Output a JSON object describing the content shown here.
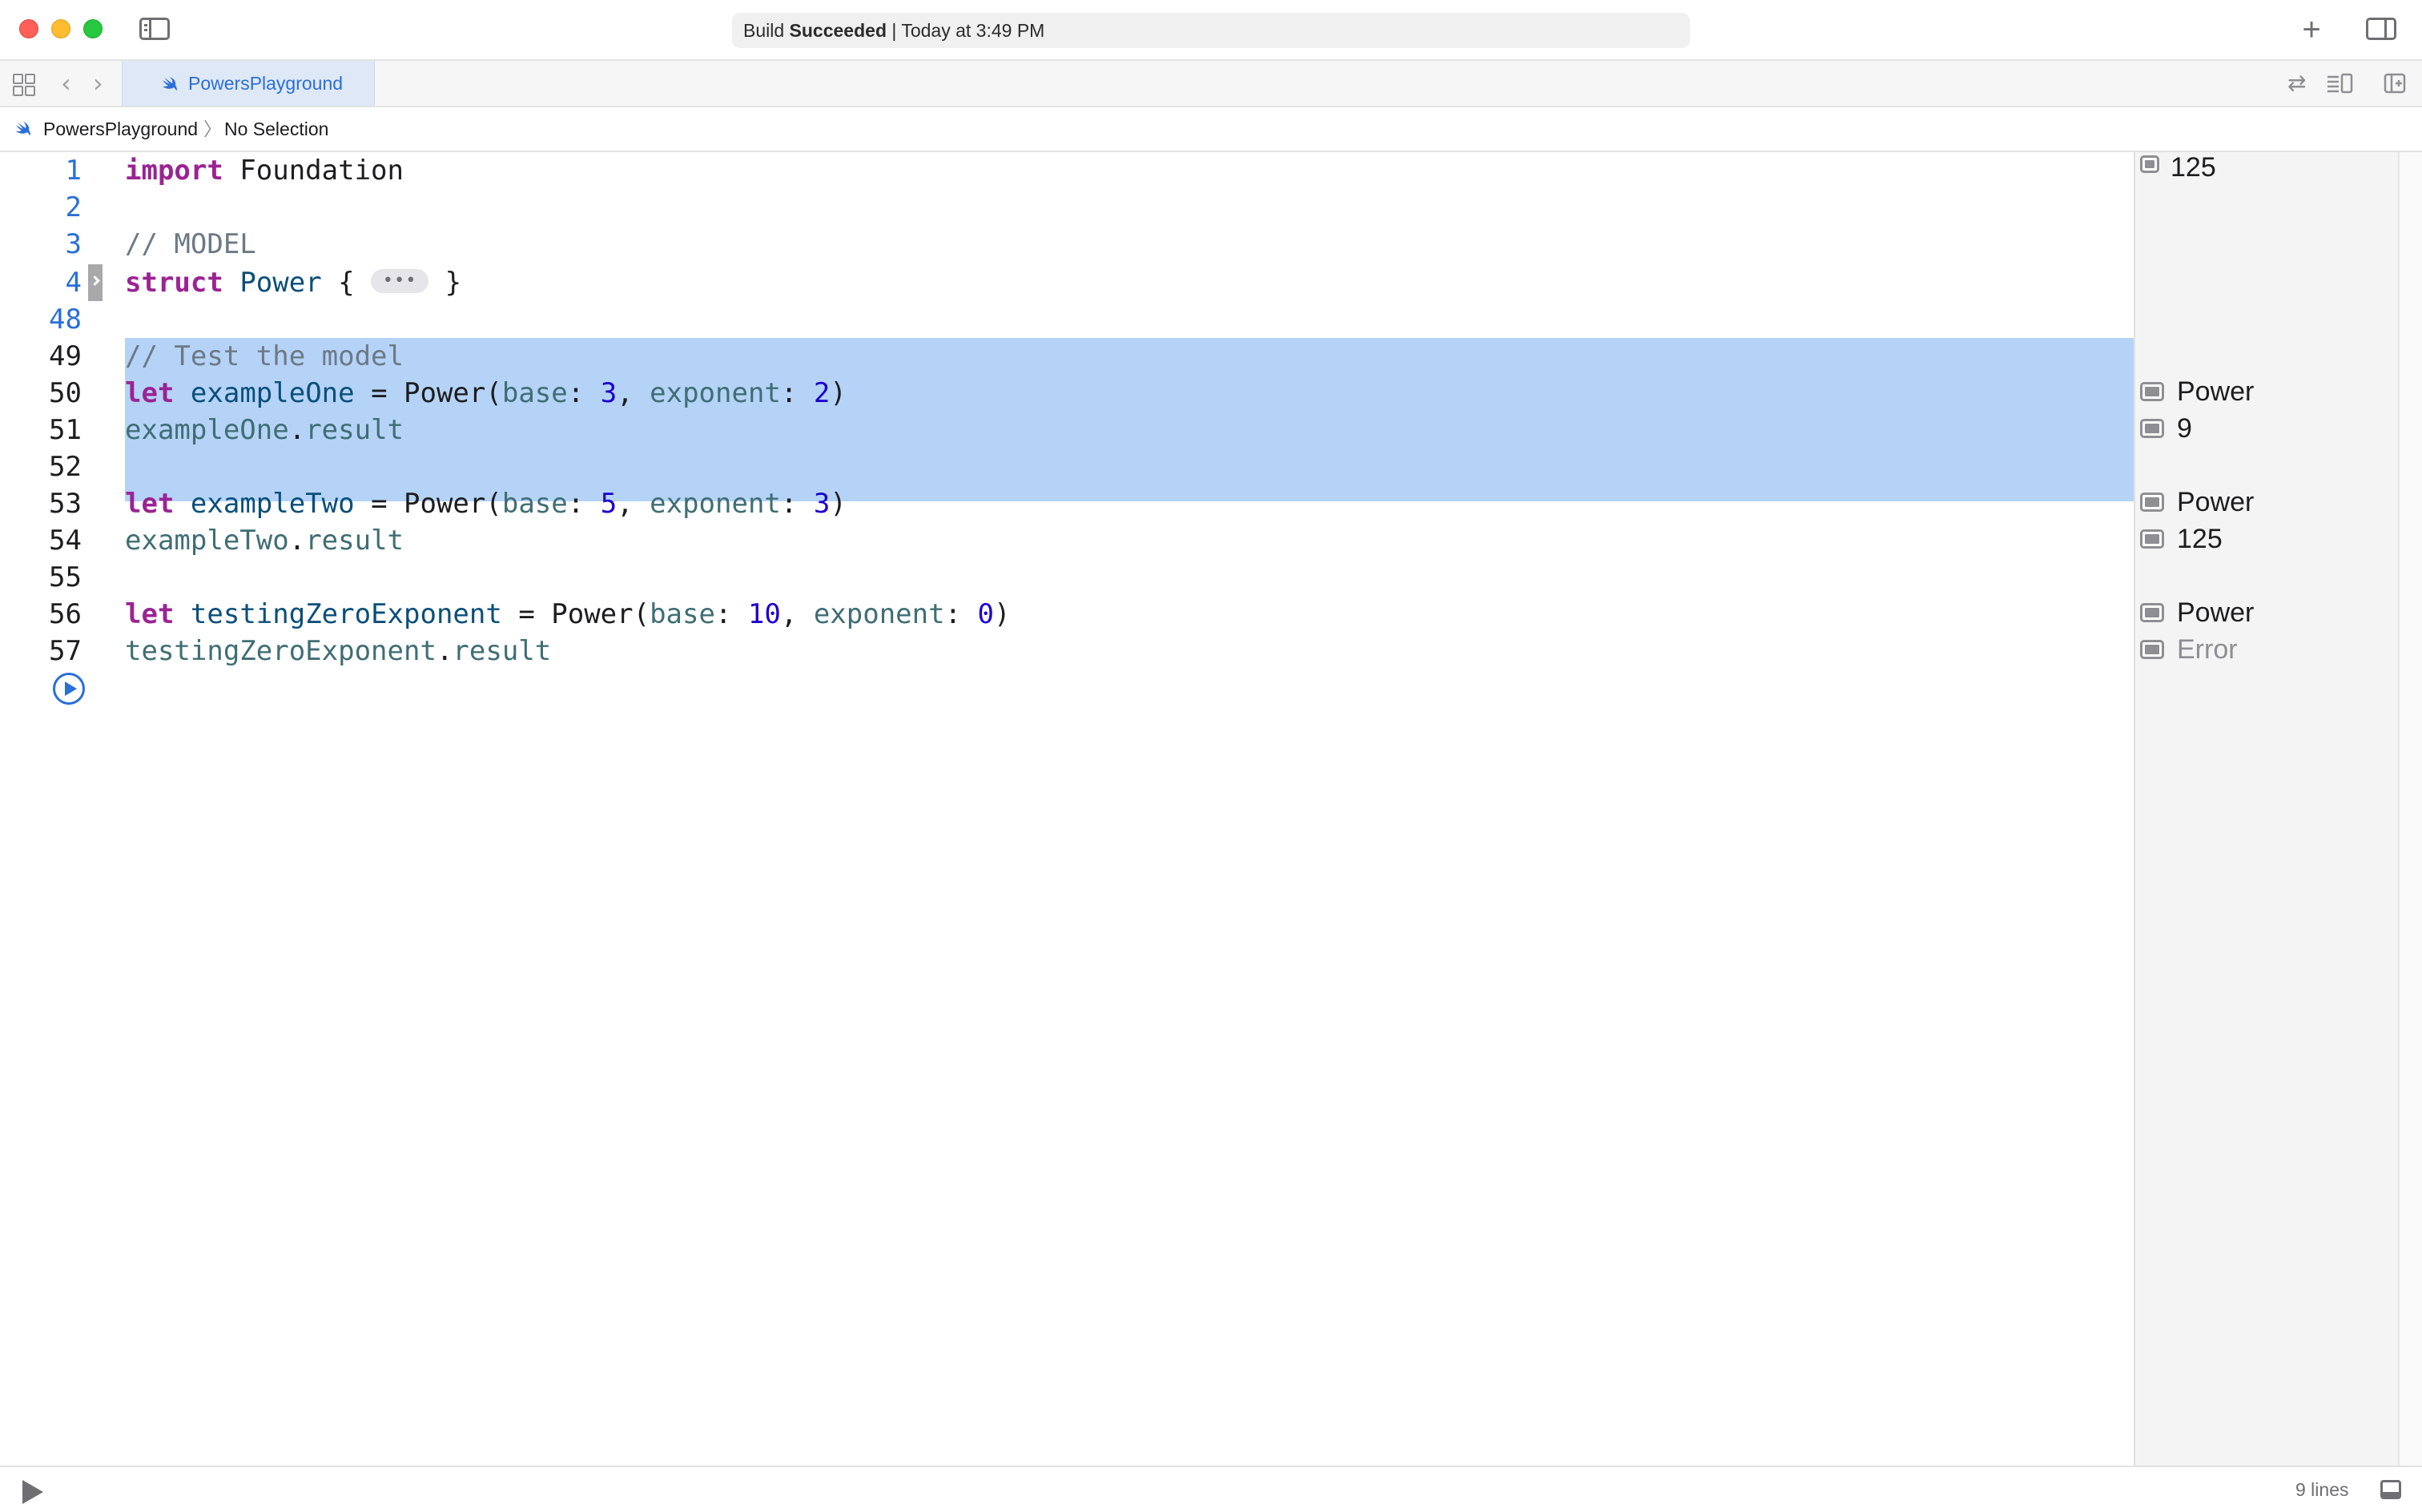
{
  "titlebar": {
    "activity_prefix": "Build ",
    "activity_status": "Succeeded",
    "activity_suffix": " | Today at 3:49 PM"
  },
  "tabbar": {
    "tab_label": "PowersPlayground"
  },
  "jumpbar": {
    "project": "PowersPlayground",
    "separator": "〉",
    "selection": "No Selection"
  },
  "editor": {
    "line_numbers": [
      "1",
      "2",
      "3",
      "4",
      "48",
      "49",
      "50",
      "51",
      "52",
      "53",
      "54",
      "55",
      "56",
      "57"
    ],
    "lines": {
      "l1": {
        "kw": "import",
        "rest": " Foundation"
      },
      "l3": {
        "comment": "// MODEL"
      },
      "l4": {
        "kw": "struct",
        "type": "Power",
        "open": " { ",
        "close": " }",
        "fold": "•••"
      },
      "l49": {
        "comment": "// Test the model"
      },
      "l50": {
        "kw": "let",
        "var": "exampleOne",
        "eq": " = Power(",
        "p1": "base",
        "v1": "3",
        "p2": "exponent",
        "v2": "2",
        "end": ")"
      },
      "l51": {
        "var": "exampleOne",
        "dot": ".",
        "prop": "result"
      },
      "l53": {
        "kw": "let",
        "var": "exampleTwo",
        "eq": " = Power(",
        "p1": "base",
        "v1": "5",
        "p2": "exponent",
        "v2": "3",
        "end": ")"
      },
      "l54": {
        "var": "exampleTwo",
        "dot": ".",
        "prop": "result"
      },
      "l56": {
        "kw": "let",
        "var": "testingZeroExponent",
        "eq": " = Power(",
        "p1": "base",
        "v1": "10",
        "p2": "exponent",
        "v2": "0",
        "end": ")"
      },
      "l57": {
        "var": "testingZeroExponent",
        "dot": ".",
        "prop": "result"
      }
    }
  },
  "results": {
    "r_top": "125",
    "r50": "Power",
    "r51": "9",
    "r53": "Power",
    "r54": "125",
    "r56": "Power",
    "r57": "Error"
  },
  "bottombar": {
    "line_count": "9 lines"
  },
  "colors": {
    "keyword": "#9b2393",
    "type": "#0b4f79",
    "comment": "#6c7986",
    "number": "#1c00cf",
    "param": "#3f6e74",
    "selection": "#b4d3f7",
    "accent": "#2a6fd6"
  },
  "icons": [
    "close-icon",
    "minimize-icon",
    "maximize-icon",
    "sidebar-toggle-icon",
    "plus-icon",
    "inspector-toggle-icon",
    "grid-icon",
    "back-icon",
    "forward-icon",
    "swift-icon",
    "swap-icon",
    "adjust-editor-icon",
    "add-editor-icon",
    "run-icon",
    "play-icon",
    "debug-area-icon",
    "quick-look-icon"
  ]
}
